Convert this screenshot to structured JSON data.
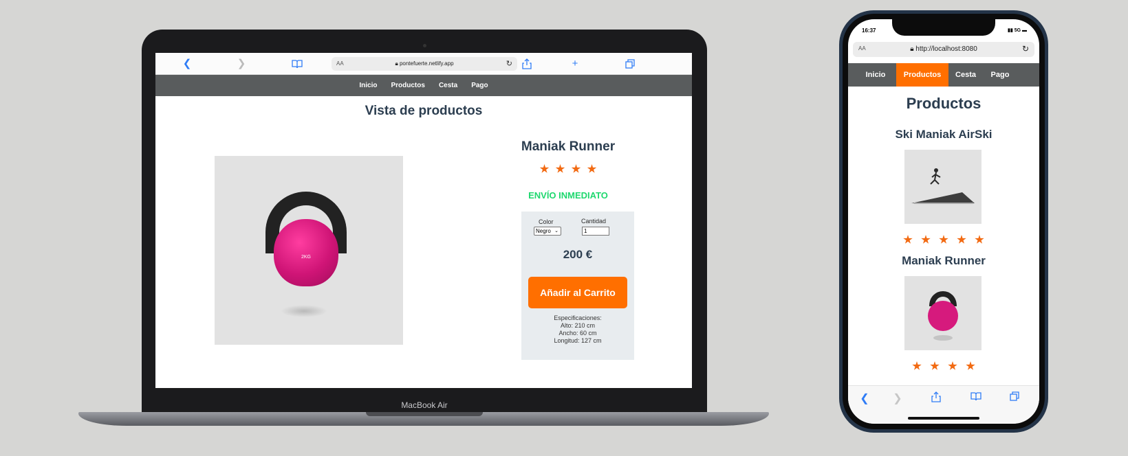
{
  "laptop": {
    "device_label": "MacBook Air",
    "browser": {
      "text_size_label": "AA",
      "url": "pontefuerte.netlify.app",
      "back_icon": "chevron-left-icon",
      "forward_icon": "chevron-right-icon",
      "bookmarks_icon": "book-icon",
      "reload_icon": "reload-icon",
      "share_icon": "share-icon",
      "new_tab_icon": "plus-icon",
      "tabs_icon": "tabs-icon"
    },
    "nav": [
      "Inicio",
      "Productos",
      "Cesta",
      "Pago"
    ],
    "page_title": "Vista de productos",
    "product": {
      "name": "Maniak Runner",
      "rating": 4,
      "shipping": "ENVÍO INMEDIATO",
      "image_label": "2KG",
      "color_label": "Color",
      "color_value": "Negro",
      "quantity_label": "Cantidad",
      "quantity_value": "1",
      "price": "200 €",
      "cart_button": "Añadir al Carrito",
      "specs": [
        "Especificaciones:",
        "Alto: 210 cm",
        "Ancho: 60 cm",
        "Longitud: 127 cm"
      ]
    }
  },
  "phone": {
    "time": "16:37",
    "signal": "5G",
    "browser": {
      "text_size_label": "AA",
      "url": "http://localhost:8080"
    },
    "nav": [
      "Inicio",
      "Productos",
      "Cesta",
      "Pago"
    ],
    "active_nav": "Productos",
    "page_title": "Productos",
    "products": [
      {
        "name": "Ski Maniak AirSki",
        "rating": 5
      },
      {
        "name": "Maniak Runner",
        "rating": 4
      }
    ]
  },
  "colors": {
    "accent": "#ff6f00",
    "star": "#f26a12",
    "nav_bg": "#595c5d",
    "shipping": "#1ed86e",
    "title": "#2c3e50",
    "ios_blue": "#2f7cf6"
  }
}
